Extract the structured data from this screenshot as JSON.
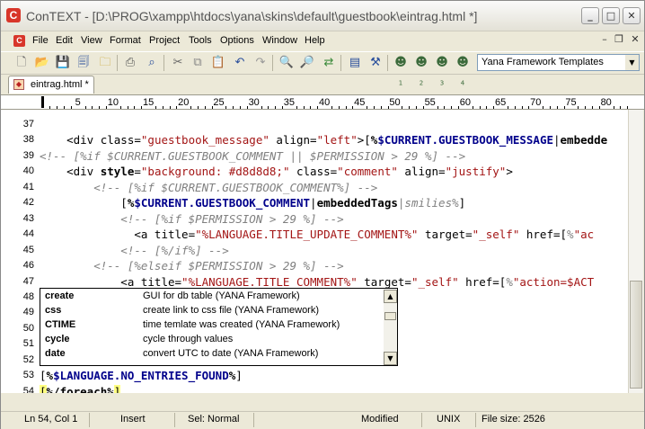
{
  "window": {
    "title": "ConTEXT - [D:\\PROG\\xampp\\htdocs\\yana\\skins\\default\\guestbook\\eintrag.html *]"
  },
  "menu": [
    "File",
    "Edit",
    "View",
    "Format",
    "Project",
    "Tools",
    "Options",
    "Window",
    "Help"
  ],
  "toolbar": {
    "icons": [
      "new-file-icon",
      "open-folder-icon",
      "save-icon",
      "save-all-icon",
      "open-folder-alt-icon",
      "print-icon",
      "print-preview-icon",
      "cut-icon",
      "copy-icon",
      "paste-icon",
      "undo-icon",
      "redo-icon",
      "find-icon",
      "find-next-icon",
      "replace-icon",
      "file-properties-icon",
      "tools-icon",
      "user-command-1-icon",
      "user-command-2-icon",
      "user-command-3-icon",
      "user-command-4-icon"
    ],
    "template_select": "Yana Framework Templates"
  },
  "tab": {
    "label": "eintrag.html *"
  },
  "ruler": [
    "5",
    "10",
    "15",
    "20",
    "25",
    "30",
    "35",
    "40",
    "45",
    "50",
    "55",
    "60",
    "65",
    "70",
    "75",
    "80"
  ],
  "lines": [
    {
      "n": "37",
      "code": []
    },
    {
      "n": "38",
      "code": [
        {
          "c": "at",
          "t": "    <div class="
        },
        {
          "c": "st",
          "t": "\"guestbook_message\""
        },
        {
          "c": "at",
          "t": " align="
        },
        {
          "c": "st",
          "t": "\"left\""
        },
        {
          "c": "at",
          "t": ">["
        },
        {
          "c": "dl",
          "t": "%"
        },
        {
          "c": "var",
          "t": "$CURRENT.GUESTBOOK_MESSAGE"
        },
        {
          "c": "pipe",
          "t": "|"
        },
        {
          "c": "fnb",
          "t": "embedde"
        }
      ]
    },
    {
      "n": "39",
      "code": [
        {
          "c": "cm",
          "t": "<!-- [%if $CURRENT.GUESTBOOK_COMMENT || $PERMISSION > 29 %] -->"
        }
      ]
    },
    {
      "n": "40",
      "code": [
        {
          "c": "at",
          "t": "    <div "
        },
        {
          "c": "fnb",
          "t": "style"
        },
        {
          "c": "at",
          "t": "="
        },
        {
          "c": "st",
          "t": "\"background: #d8d8d8;\""
        },
        {
          "c": "at",
          "t": " class="
        },
        {
          "c": "st",
          "t": "\"comment\""
        },
        {
          "c": "at",
          "t": " align="
        },
        {
          "c": "st",
          "t": "\"justify\""
        },
        {
          "c": "at",
          "t": ">"
        }
      ]
    },
    {
      "n": "41",
      "code": [
        {
          "c": "cm",
          "t": "        <!-- [%if $CURRENT.GUESTBOOK_COMMENT%] -->"
        }
      ]
    },
    {
      "n": "42",
      "code": [
        {
          "c": "at",
          "t": "            ["
        },
        {
          "c": "dl",
          "t": "%"
        },
        {
          "c": "var",
          "t": "$CURRENT.GUESTBOOK_COMMENT"
        },
        {
          "c": "pipe",
          "t": "|"
        },
        {
          "c": "fnb",
          "t": "embeddedTags"
        },
        {
          "c": "cm",
          "t": "|smilies%"
        },
        {
          "c": "at",
          "t": "]"
        }
      ]
    },
    {
      "n": "43",
      "code": [
        {
          "c": "cm",
          "t": "            <!-- [%if $PERMISSION > 29 %] -->"
        }
      ]
    },
    {
      "n": "44",
      "code": [
        {
          "c": "at",
          "t": "              <a title="
        },
        {
          "c": "st",
          "t": "\"%LANGUAGE.TITLE_UPDATE_COMMENT%\""
        },
        {
          "c": "at",
          "t": " target="
        },
        {
          "c": "st",
          "t": "\"_self\""
        },
        {
          "c": "at",
          "t": " href=["
        },
        {
          "c": "cm",
          "t": "%"
        },
        {
          "c": "st",
          "t": "\"ac"
        }
      ]
    },
    {
      "n": "45",
      "code": [
        {
          "c": "cm",
          "t": "            <!-- [%/if%] -->"
        }
      ]
    },
    {
      "n": "46",
      "code": [
        {
          "c": "cm",
          "t": "        <!-- [%elseif $PERMISSION > 29 %] -->"
        }
      ]
    },
    {
      "n": "47",
      "code": [
        {
          "c": "at",
          "t": "            <a title="
        },
        {
          "c": "st",
          "t": "\"%LANGUAGE.TITLE_COMMENT%\""
        },
        {
          "c": "at",
          "t": " target="
        },
        {
          "c": "st",
          "t": "\"_self\""
        },
        {
          "c": "at",
          "t": " href=["
        },
        {
          "c": "cm",
          "t": "%"
        },
        {
          "c": "st",
          "t": "\"action=$ACT"
        }
      ]
    },
    {
      "n": "48",
      "code": []
    },
    {
      "n": "49",
      "code": []
    },
    {
      "n": "50",
      "code": []
    },
    {
      "n": "51",
      "code": []
    },
    {
      "n": "52",
      "code": []
    },
    {
      "n": "53",
      "code": [
        {
          "c": "at",
          "t": "["
        },
        {
          "c": "dl",
          "t": "%"
        },
        {
          "c": "var",
          "t": "$LANGUAGE.NO_ENTRIES_FOUND"
        },
        {
          "c": "dl",
          "t": "%"
        },
        {
          "c": "at",
          "t": "]"
        }
      ]
    },
    {
      "n": "54",
      "code": [
        {
          "c": "at",
          "t": "["
        },
        {
          "c": "dl",
          "t": "%/foreach%"
        },
        {
          "c": "at",
          "t": "]"
        }
      ]
    }
  ],
  "autocomplete": [
    {
      "name": "create",
      "desc": "GUI for db table (YANA Framework)"
    },
    {
      "name": "css",
      "desc": "create link to css file (YANA Framework)"
    },
    {
      "name": "CTIME",
      "desc": "time temlate was created (YANA Framework)"
    },
    {
      "name": "cycle",
      "desc": "cycle through values"
    },
    {
      "name": "date",
      "desc": "convert UTC to date (YANA Framework)"
    }
  ],
  "status": {
    "position": "Ln 54, Col 1",
    "mode": "Insert",
    "selection": "Sel: Normal",
    "modified": "Modified",
    "eol": "UNIX",
    "filesize": "File size: 2526"
  },
  "colors": {
    "string": "#a31515",
    "comment": "#808080",
    "variable": "#00008b",
    "bracket_highlight": "#ffff80"
  }
}
